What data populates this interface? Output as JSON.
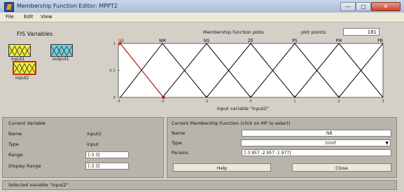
{
  "window": {
    "title": "Membership Function Editor: MPPT2",
    "min_label": "—",
    "max_label": "□",
    "close_label": "✕"
  },
  "menu": [
    "File",
    "Edit",
    "View"
  ],
  "fis": {
    "title": "FIS Variables",
    "variables": [
      {
        "name": "input1",
        "color": "#f3ec3a"
      },
      {
        "name": "output1",
        "color": "#6fd0de"
      },
      {
        "name": "input2",
        "color": "#f3ec3a",
        "selected": true
      }
    ]
  },
  "plot": {
    "plots_label": "Membership function plots",
    "points_label": "plot points:",
    "points_value": "181",
    "axis_label": "input variable \"input2\""
  },
  "chart_data": {
    "type": "line",
    "xlabel": "input variable \"input2\"",
    "xlim": [
      -3,
      3
    ],
    "ylim": [
      0,
      1
    ],
    "yticks": [
      "0",
      "0.5",
      "1"
    ],
    "xticks": [
      "-3",
      "-2",
      "-1",
      "0",
      "1",
      "2",
      "3"
    ],
    "series": [
      {
        "name": "NB",
        "x": [
          -3.957,
          -2.957,
          -1.977
        ],
        "y": [
          0,
          1,
          0
        ],
        "color": "#c0392b"
      },
      {
        "name": "NM",
        "x": [
          -2.957,
          -2.0,
          -1.0
        ],
        "y": [
          0,
          1,
          0
        ]
      },
      {
        "name": "NS",
        "x": [
          -2.0,
          -1.0,
          0.0
        ],
        "y": [
          0,
          1,
          0
        ]
      },
      {
        "name": "ZE",
        "x": [
          -1.0,
          0.0,
          1.0
        ],
        "y": [
          0,
          1,
          0
        ]
      },
      {
        "name": "PS",
        "x": [
          0.0,
          1.0,
          2.0
        ],
        "y": [
          0,
          1,
          0
        ]
      },
      {
        "name": "PM",
        "x": [
          1.0,
          2.0,
          3.0
        ],
        "y": [
          0,
          1,
          0
        ]
      },
      {
        "name": "PB",
        "x": [
          2.0,
          3.0,
          4.0
        ],
        "y": [
          0,
          1,
          0
        ]
      }
    ]
  },
  "current_variable": {
    "title": "Current Variable",
    "name_label": "Name",
    "name_value": "input2",
    "type_label": "Type",
    "type_value": "input",
    "range_label": "Range",
    "range_value": "[-3 3]",
    "display_range_label": "Display Range",
    "display_range_value": "[-3 3]"
  },
  "current_mf": {
    "title": "Current Membership Function (click on MF to select)",
    "name_label": "Name",
    "name_value": "NB",
    "type_label": "Type",
    "type_value": "trimf",
    "params_label": "Params",
    "params_value": "[-3.957 -2.957 -1.977]",
    "help_label": "Help",
    "close_label": "Close"
  },
  "status": "Selected variable \"input2\""
}
